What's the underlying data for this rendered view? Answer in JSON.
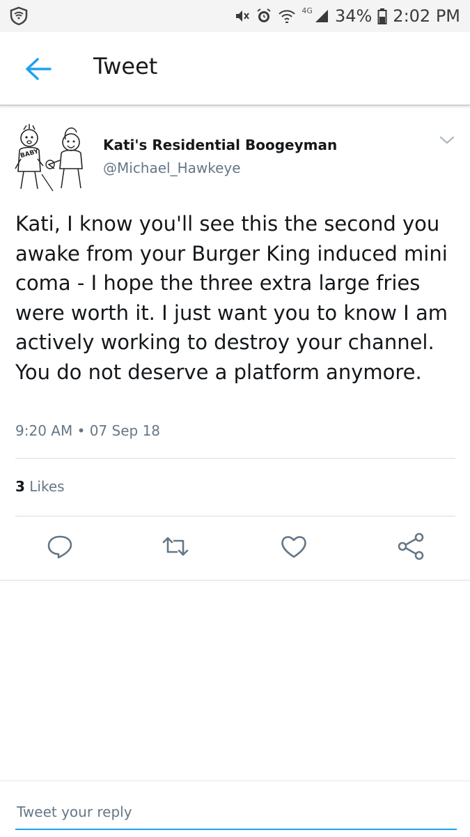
{
  "status_bar": {
    "network": "4G",
    "battery": "34%",
    "time": "2:02 PM",
    "icons": [
      "shield-icon",
      "mute-icon",
      "alarm-icon",
      "wifi-icon",
      "signal-icon",
      "battery-icon"
    ]
  },
  "header": {
    "title": "Tweet",
    "back_icon": "back-arrow-icon"
  },
  "tweet": {
    "display_name": "Kati's Residential Boogeyman",
    "handle": "@Michael_Hawkeye",
    "avatar_text": "BABY",
    "text": "Kati, I know you'll see this the second you awake from your Burger King induced mini coma - I hope the three extra large fries were worth it. I just want you to know I am actively working to destroy your channel. You do not deserve a platform anymore.",
    "timestamp": "9:20 AM • 07 Sep 18",
    "likes_count": "3",
    "likes_label": "Likes"
  },
  "actions": [
    "reply-icon",
    "retweet-icon",
    "like-icon",
    "share-icon"
  ],
  "reply": {
    "placeholder": "Tweet your reply"
  },
  "colors": {
    "accent": "#1da1f2",
    "secondary_text": "#657786",
    "status_bar_bg": "#f4f4f4"
  }
}
